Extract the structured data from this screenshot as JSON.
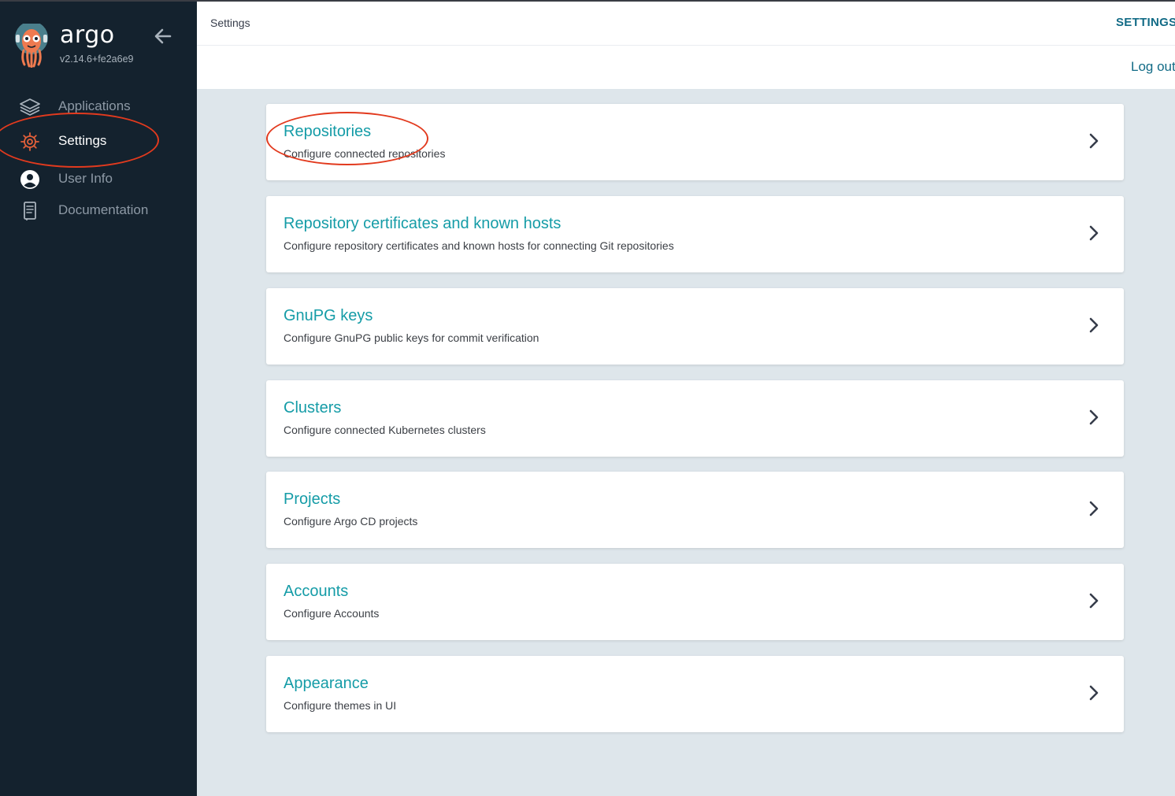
{
  "brand": {
    "name": "argo",
    "version": "v2.14.6+fe2a6e9"
  },
  "sidebar": {
    "items": [
      {
        "label": "Applications",
        "icon": "layers-icon"
      },
      {
        "label": "Settings",
        "icon": "gear-icon",
        "active": true
      },
      {
        "label": "User Info",
        "icon": "user-icon"
      },
      {
        "label": "Documentation",
        "icon": "book-icon"
      }
    ]
  },
  "header": {
    "title": "Settings",
    "tab": "SETTINGS",
    "logout": "Log out"
  },
  "cards": [
    {
      "title": "Repositories",
      "desc": "Configure connected repositories"
    },
    {
      "title": "Repository certificates and known hosts",
      "desc": "Configure repository certificates and known hosts for connecting Git repositories"
    },
    {
      "title": "GnuPG keys",
      "desc": "Configure GnuPG public keys for commit verification"
    },
    {
      "title": "Clusters",
      "desc": "Configure connected Kubernetes clusters"
    },
    {
      "title": "Projects",
      "desc": "Configure Argo CD projects"
    },
    {
      "title": "Accounts",
      "desc": "Configure Accounts"
    },
    {
      "title": "Appearance",
      "desc": "Configure themes in UI"
    }
  ],
  "colors": {
    "sidebar_bg": "#14222e",
    "accent": "#159ca7",
    "link": "#126b86",
    "annotation": "#e23a1e",
    "content_bg": "#dee6eb"
  }
}
